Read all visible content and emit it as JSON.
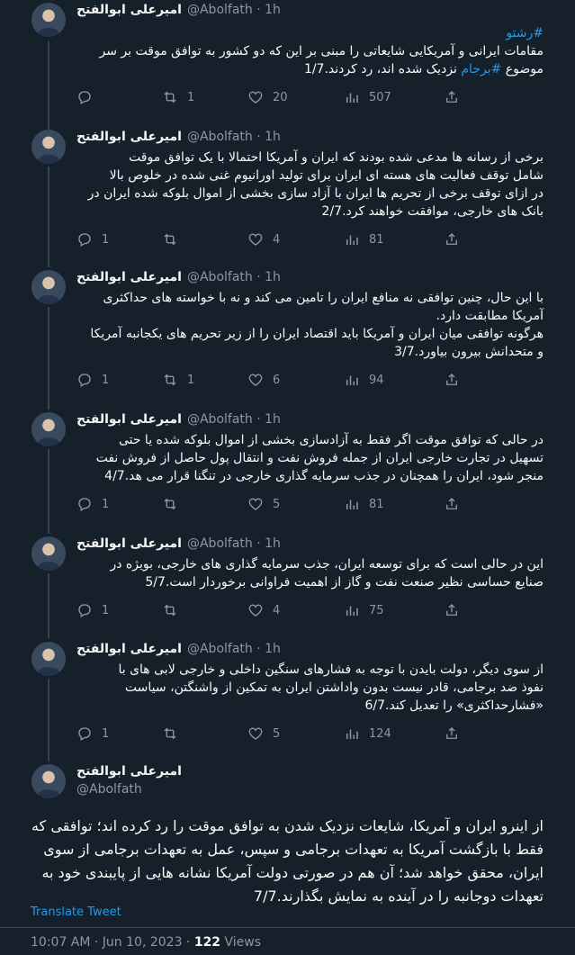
{
  "author": {
    "name": "امیرعلی ابوالفتح",
    "handle": "@Abolfath",
    "time": "1h",
    "dot": "·"
  },
  "tweets": [
    {
      "hashtag": "#رشتو",
      "text": "مقامات ایرانی و آمریکایی شایعاتی را مبنی بر این که دو کشور به توافق موقت بر سر\nموضوع #برجام نزدیک شده اند، رد کردند.1/7",
      "replies": "",
      "retweets": "1",
      "likes": "20",
      "views": "507"
    },
    {
      "text": "برخی از رسانه ها مدعی شده بودند که ایران و آمریکا احتمالا با یک توافق موقت\nشامل توقف فعالیت های هسته ای ایران برای تولید اورانیوم غنی شده در خلوص بالا\nدر ازای توقف برخی از تحریم ها ایران با آزاد سازی بخشی از اموال بلوکه شده ایران در\nبانک های خارجی، موافقت خواهند کرد.2/7",
      "replies": "1",
      "retweets": "",
      "likes": "4",
      "views": "81"
    },
    {
      "text": "با این حال، چنین توافقی نه منافع ایران را تامین می کند و نه با خواسته های حداکثری\nآمریکا مطابقت دارد.\nهرگونه توافقی میان ایران و آمریکا باید اقتصاد ایران را از زیر تحریم های یکجانبه آمریکا\nو متحدانش بیرون بیاورد.3/7",
      "replies": "1",
      "retweets": "1",
      "likes": "6",
      "views": "94"
    },
    {
      "text": "در حالی که توافق موقت اگر فقط به آزادسازی بخشی از اموال بلوکه شده یا حتی\nتسهیل در تجارت خارجی ایران از جمله فروش نفت و انتقال پول حاصل از فروش نفت\nمنجر شود، ایران را همچنان در جذب سرمایه گذاری خارجی در تنگنا قرار می هد.4/7",
      "replies": "1",
      "retweets": "",
      "likes": "5",
      "views": "81"
    },
    {
      "text": "این در حالی است که برای توسعه ایران، جذب سرمایه گذاری های خارجی، بویژه در\nصنایع حساسی نظیر صنعت نفت و گاز از اهمیت فراوانی برخوردار است.5/7",
      "replies": "1",
      "retweets": "",
      "likes": "4",
      "views": "75"
    },
    {
      "text": "از سوی دیگر، دولت بایدن با توجه به فشارهای سنگین داخلی و خارجی لابی های با\nنفوذ ضد برجامی، قادر نیست بدون واداشتن ایران به تمکین از واشنگتن، سیاست\n«فشارحداکثری» را تعدیل کند.6/7",
      "replies": "1",
      "retweets": "",
      "likes": "5",
      "views": "124"
    }
  ],
  "main_tweet": {
    "text": "از اینرو ایران و آمریکا، شایعات نزدیک شدن به توافق موقت را رد کرده اند؛ توافقی که\nفقط با بازگشت آمریکا به تعهدات برجامی و سپس، عمل به تعهدات برجامی از سوی\nایران، محقق خواهد شد؛ آن هم در صورتی دولت آمریکا نشانه هایی از پایبندی خود به\nتعهدات دوجانبه را در آینده به نمایش بگذارند.7/7",
    "translate_label": "Translate Tweet",
    "timestamp": "10:07 AM · Jun 10, 2023 · ",
    "views_count": "122",
    "views_label": " Views"
  },
  "colors": {
    "background": "#15202b",
    "link": "#1d9bf0",
    "muted": "#8b98a5",
    "border": "#38444d"
  }
}
